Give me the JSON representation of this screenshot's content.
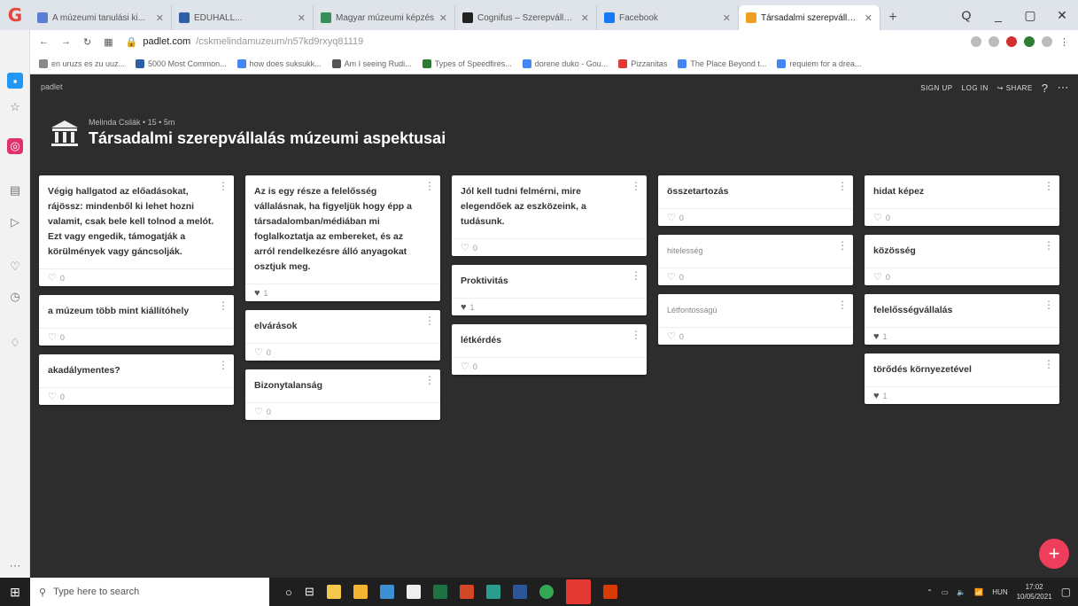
{
  "browser": {
    "tabs": [
      {
        "label": "A múzeumi tanulási ki...",
        "color": "#5b7fd6"
      },
      {
        "label": "EDUHALL...",
        "color": "#2e5ea8"
      },
      {
        "label": "Magyar múzeumi képzés",
        "color": "#3a8e5c"
      },
      {
        "label": "Cognifus – Szerepvállalás",
        "color": "#222222"
      },
      {
        "label": "Facebook",
        "color": "#1877f2"
      },
      {
        "label": "Társadalmi szerepvállalás",
        "color": "#f0a020",
        "active": true
      }
    ],
    "new_tab": "+",
    "window_controls": [
      "Q",
      "_",
      "▢",
      "✕"
    ],
    "url_host": "padlet.com",
    "url_path": "/cskmelindamuzeum/n57kd9rxyq81119",
    "bookmarks": [
      {
        "label": "en uruzs es zu uuz...",
        "color": "#888"
      },
      {
        "label": "5000 Most Common...",
        "color": "#2e5ea8"
      },
      {
        "label": "how does suksukk...",
        "color": "#4285f4"
      },
      {
        "label": "Am I seeing Rudi...",
        "color": "#555"
      },
      {
        "label": "Types of Speedfires...",
        "color": "#2e7d32"
      },
      {
        "label": "dorene duko - Gou...",
        "color": "#4285f4"
      },
      {
        "label": "Pizzanitas",
        "color": "#e53935"
      },
      {
        "label": "The Place Beyond t...",
        "color": "#4285f4"
      },
      {
        "label": "requiem for a drea...",
        "color": "#4285f4"
      }
    ]
  },
  "padlet": {
    "brand": "padlet",
    "top_actions": [
      "SIGN UP",
      "LOG IN",
      "SHARE"
    ],
    "author": "Melinda Csilák • 15 • 5m",
    "title": "Társadalmi szerepvállalás múzeumi aspektusai",
    "fab": "+",
    "columns": [
      [
        {
          "text": "Végig hallgatod az előadásokat, rájössz: mindenből ki lehet hozni valamit, csak bele kell tolnod a melót. Ezt vagy engedik, támogatják a körülmények vagy gáncsolják.",
          "likes": "0",
          "liked": false
        },
        {
          "text": "a múzeum több mint kiállítóhely",
          "likes": "0",
          "liked": false
        },
        {
          "text": "akadálymentes?",
          "likes": "0",
          "liked": false
        }
      ],
      [
        {
          "text": "Az is egy része a felelősség vállalásnak, ha figyeljük hogy épp a társadalomban/médiában mi foglalkoztatja az embereket, és az arról rendelkezésre álló anyagokat osztjuk meg.",
          "likes": "1",
          "liked": true
        },
        {
          "text": "elvárások",
          "likes": "0",
          "liked": false
        },
        {
          "text": "Bizonytalanság",
          "likes": "0",
          "liked": false
        }
      ],
      [
        {
          "text": "Jól kell tudni felmérni, mire elegendőek az eszközeink, a tudásunk.",
          "likes": "0",
          "liked": false
        },
        {
          "text": "Proktivitás",
          "likes": "1",
          "liked": true
        },
        {
          "text": "létkérdés",
          "likes": "0",
          "liked": false
        }
      ],
      [
        {
          "text": "összetartozás",
          "likes": "0",
          "liked": false
        },
        {
          "text": "hitelesség",
          "likes": "0",
          "liked": false,
          "light": true
        },
        {
          "text": "Létfontosságú",
          "likes": "0",
          "liked": false,
          "light": true
        }
      ],
      [
        {
          "text": "hidat képez",
          "likes": "0",
          "liked": false
        },
        {
          "text": "közösség",
          "likes": "0",
          "liked": false
        },
        {
          "text": "felelősségvállalás",
          "likes": "1",
          "liked": true
        },
        {
          "text": "törődés környezetével",
          "likes": "1",
          "liked": true
        }
      ]
    ]
  },
  "taskbar": {
    "search_placeholder": "Type here to search",
    "language": "HUN",
    "time": "17:02",
    "date": "10/05/2021"
  }
}
